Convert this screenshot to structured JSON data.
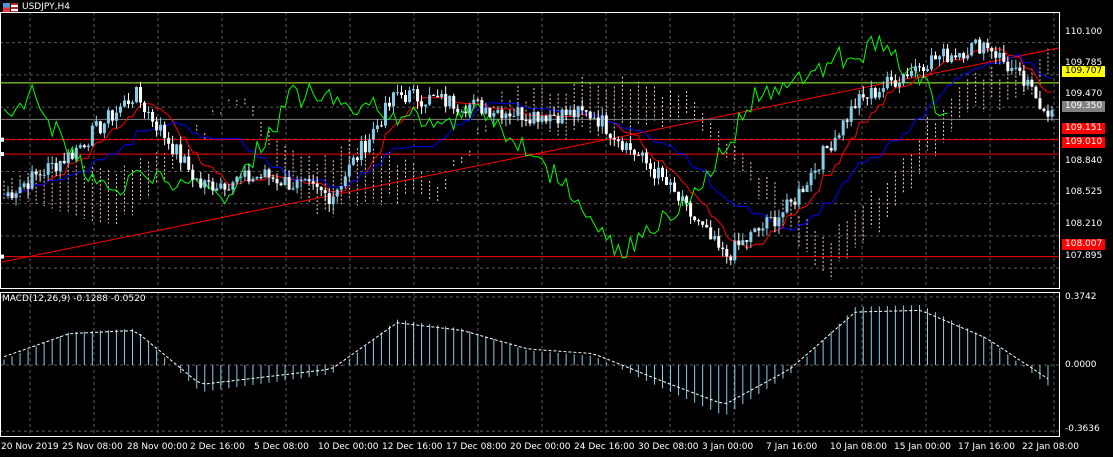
{
  "header": {
    "symbol_title": "USDJPY,H4"
  },
  "macd_panel": {
    "title": "MACD(12,26,9) -0.1288 -0.0520",
    "scale_labels": [
      "0.3742",
      "0.0000",
      "-0.3636"
    ]
  },
  "price_axis": {
    "ticks": [
      "110.100",
      "109.785",
      "109.470",
      "108.840",
      "108.525",
      "108.210",
      "107.895"
    ],
    "tags": [
      {
        "text": "109.707",
        "bg": "#ffff00",
        "fg": "#000000"
      },
      {
        "text": "109.350",
        "bg": "#808080",
        "fg": "#ffffff"
      },
      {
        "text": "109.151",
        "bg": "#ff0000",
        "fg": "#ffffff"
      },
      {
        "text": "109.010",
        "bg": "#ff0000",
        "fg": "#ffffff"
      },
      {
        "text": "108.007",
        "bg": "#ff0000",
        "fg": "#ffffff"
      }
    ]
  },
  "time_axis": {
    "labels": [
      "20 Nov 2019",
      "25 Nov 08:00",
      "28 Nov 00:00",
      "2 Dec 16:00",
      "5 Dec 08:00",
      "10 Dec 00:00",
      "12 Dec 16:00",
      "17 Dec 08:00",
      "20 Dec 00:00",
      "24 Dec 16:00",
      "30 Dec 08:00",
      "3 Jan 00:00",
      "7 Jan 16:00",
      "10 Jan 08:00",
      "15 Jan 00:00",
      "17 Jan 16:00",
      "22 Jan 08:00"
    ]
  },
  "colors": {
    "background": "#000000",
    "grid": "#5a5a5a",
    "bull_candle": "#87ceeb",
    "bear_candle": "#ffffff",
    "tenkan": "#ff0000",
    "kijun": "#0000ff",
    "chikou": "#00ff00",
    "cloud": "#f5cfb9",
    "trendline": "#ff0000",
    "horizontal_green": "#adff2f",
    "macd_hist": "#87ceeb",
    "macd_signal": "#ffffff"
  },
  "chart_data": {
    "type": "candlestick",
    "title": "USDJPY,H4",
    "ylim": [
      107.7,
      110.4
    ],
    "horizontal_levels": [
      109.707,
      109.151,
      109.01,
      108.007
    ],
    "current_price": 109.35,
    "close_path": [
      [
        "20 Nov 2019",
        108.6
      ],
      [
        "25 Nov 08:00",
        109.0
      ],
      [
        "28 Nov 00:00",
        109.6
      ],
      [
        "2 Dec 16:00",
        108.7
      ],
      [
        "5 Dec 08:00",
        108.8
      ],
      [
        "10 Dec 00:00",
        108.6
      ],
      [
        "12 Dec 16:00",
        109.6
      ],
      [
        "17 Dec 08:00",
        109.5
      ],
      [
        "20 Dec 00:00",
        109.4
      ],
      [
        "24 Dec 16:00",
        109.4
      ],
      [
        "30 Dec 08:00",
        108.8
      ],
      [
        "3 Jan 00:00",
        108.0
      ],
      [
        "7 Jan 16:00",
        108.5
      ],
      [
        "10 Jan 08:00",
        109.5
      ],
      [
        "15 Jan 00:00",
        109.9
      ],
      [
        "17 Jan 16:00",
        110.1
      ],
      [
        "22 Jan 08:00",
        109.4
      ]
    ],
    "macd": {
      "name": "MACD(12,26,9)",
      "main": -0.1288,
      "signal": -0.052,
      "ylim": [
        -0.3636,
        0.3742
      ],
      "hist_path": [
        0.03,
        0.18,
        0.2,
        -0.15,
        -0.1,
        -0.05,
        0.25,
        0.2,
        0.08,
        0.05,
        -0.12,
        -0.28,
        -0.05,
        0.32,
        0.33,
        0.15,
        -0.13
      ]
    }
  }
}
